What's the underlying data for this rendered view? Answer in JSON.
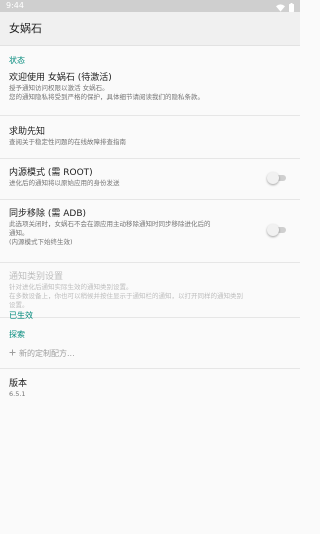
{
  "status_bar": {
    "time": "9:44"
  },
  "app_bar": {
    "title": "女娲石"
  },
  "sections": {
    "status_header": "状态",
    "active_header": "已生效",
    "explore_header": "探索"
  },
  "prefs": {
    "welcome": {
      "title": "欢迎使用 女娲石 (待激活)",
      "summary_1": "授予通知访问权限以激活 女娲石。",
      "summary_2": "您的通知隐私将受到严格的保护，具体细节请阅读我们的隐私条款。"
    },
    "help": {
      "title": "求助先知",
      "summary": "查阅关于稳定性问题的在线故障排查指南"
    },
    "root": {
      "title": "内源模式 (需 ROOT)",
      "summary": "进化后的通知将以原始应用的身份发送",
      "enabled": false
    },
    "adb": {
      "title": "同步移除 (需 ADB)",
      "summary_1": "此选项关闭时，女娲石不会在源应用主动移除通知时同步移除进化后的",
      "summary_2": "通知。",
      "summary_3": "(内源模式下始终生效)",
      "enabled": false
    },
    "channel": {
      "title": "通知类别设置",
      "summary_1": "针对进化后通知实际生效的通知类别设置。",
      "summary_2": "在多数设备上，你也可以稍候并按住显示于通知栏的通知，以打开同样的通知类别",
      "summary_3": "设置。"
    },
    "version": {
      "title": "版本",
      "summary": "6.5.1"
    }
  },
  "explore": {
    "add_label": "新的定制配方..."
  },
  "colors": {
    "accent": "#00897b",
    "disabled_text": "#bdbdbd",
    "secondary_text": "#757575"
  },
  "icons": {
    "wifi": "wifi-icon",
    "battery": "battery-icon",
    "add": "plus-icon"
  }
}
